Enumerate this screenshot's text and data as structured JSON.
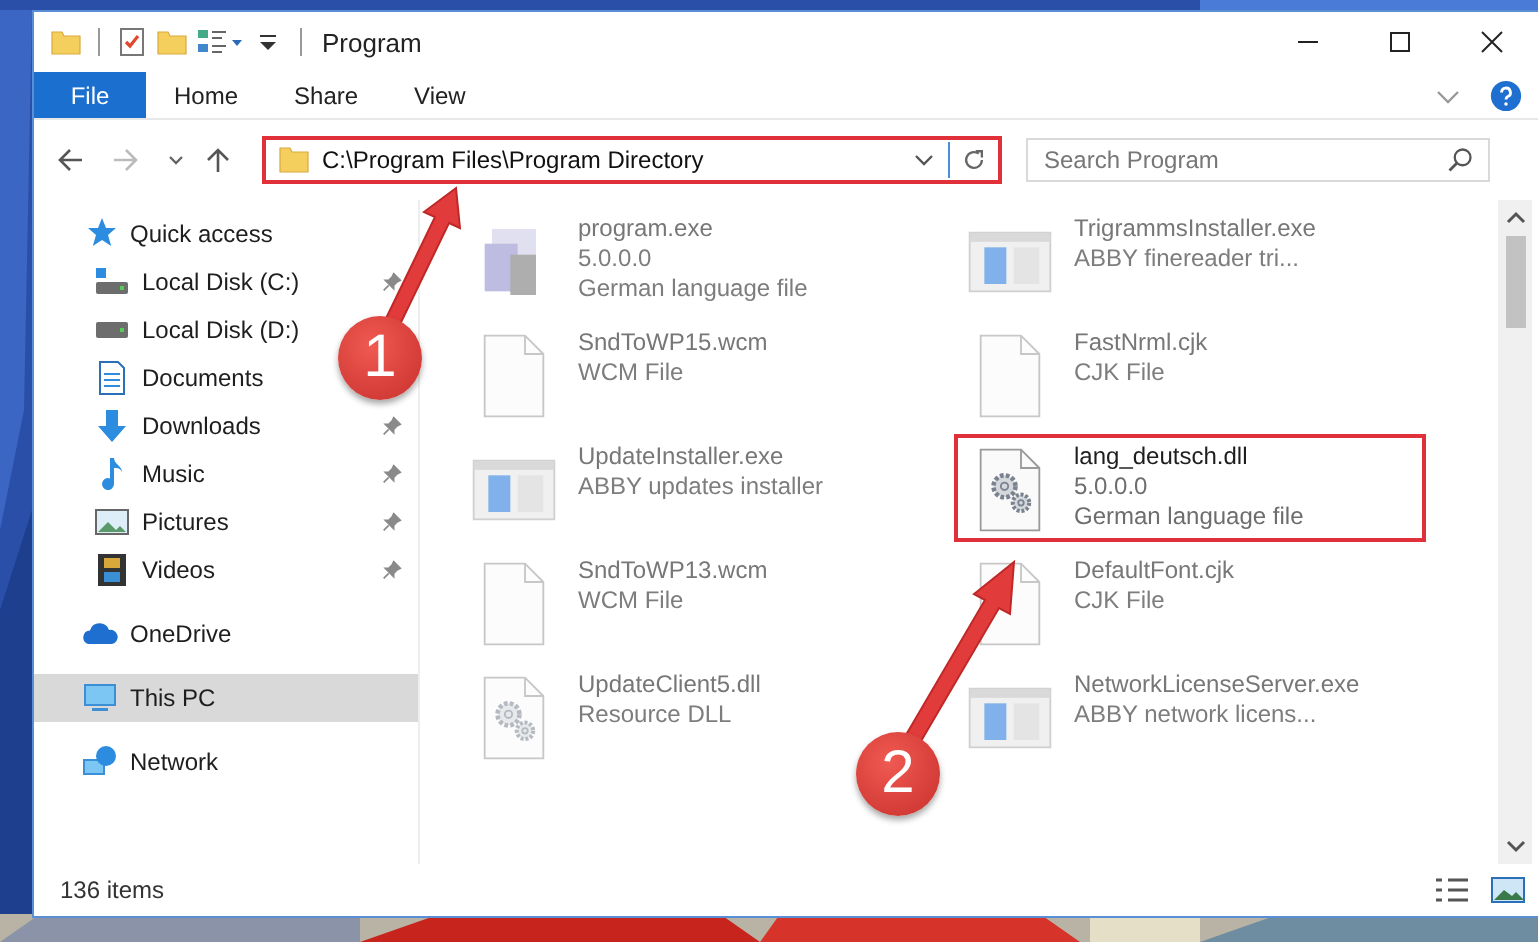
{
  "window": {
    "title": "Program"
  },
  "ribbon": {
    "tabs": [
      {
        "label": "File",
        "kind": "file",
        "selected": false
      },
      {
        "label": "Home",
        "kind": "tab",
        "selected": false
      },
      {
        "label": "Share",
        "kind": "tab",
        "selected": false
      },
      {
        "label": "View",
        "kind": "tab",
        "selected": false
      }
    ]
  },
  "address": {
    "path": "C:\\Program Files\\Program Directory",
    "highlighted": true
  },
  "search": {
    "placeholder": "Search Program"
  },
  "sidebar": {
    "items": [
      {
        "label": "Quick access",
        "kind": "quick-access",
        "selected": false,
        "children": [
          {
            "label": "Local Disk (C:)",
            "kind": "system-drive",
            "pinned": true,
            "selected": false
          },
          {
            "label": "Local Disk (D:)",
            "kind": "drive",
            "pinned": false,
            "selected": false
          },
          {
            "label": "Documents",
            "kind": "documents",
            "pinned": false,
            "selected": false
          },
          {
            "label": "Downloads",
            "kind": "downloads",
            "pinned": true,
            "selected": false
          },
          {
            "label": "Music",
            "kind": "music",
            "pinned": true,
            "selected": false
          },
          {
            "label": "Pictures",
            "kind": "pictures",
            "pinned": true,
            "selected": false
          },
          {
            "label": "Videos",
            "kind": "videos",
            "pinned": true,
            "selected": false
          }
        ]
      },
      {
        "label": "OneDrive",
        "kind": "cloud",
        "selected": false
      },
      {
        "label": "This PC",
        "kind": "computer",
        "selected": true
      },
      {
        "label": "Network",
        "kind": "network",
        "selected": false
      }
    ]
  },
  "files": [
    {
      "name": "program.exe",
      "details": [
        "5.0.0.0",
        "German language file"
      ],
      "kind": "application",
      "blurred": true,
      "highlighted": false
    },
    {
      "name": "TrigrammsInstaller.exe",
      "details": [
        "ABBY finereader tri..."
      ],
      "kind": "installer",
      "blurred": true,
      "highlighted": false
    },
    {
      "name": "SndToWP15.wcm",
      "details": [
        "WCM File"
      ],
      "kind": "document",
      "blurred": true,
      "highlighted": false
    },
    {
      "name": "FastNrml.cjk",
      "details": [
        "CJK File"
      ],
      "kind": "document",
      "blurred": true,
      "highlighted": false
    },
    {
      "name": "UpdateInstaller.exe",
      "details": [
        "ABBY updates installer"
      ],
      "kind": "installer",
      "blurred": true,
      "highlighted": false
    },
    {
      "name": "lang_deutsch.dll",
      "details": [
        "5.0.0.0",
        "German language file"
      ],
      "kind": "library",
      "blurred": false,
      "highlighted": true
    },
    {
      "name": "SndToWP13.wcm",
      "details": [
        "WCM File"
      ],
      "kind": "document",
      "blurred": true,
      "highlighted": false
    },
    {
      "name": "DefaultFont.cjk",
      "details": [
        "CJK File"
      ],
      "kind": "document",
      "blurred": true,
      "highlighted": false
    },
    {
      "name": "UpdateClient5.dll",
      "details": [
        "Resource DLL"
      ],
      "kind": "library",
      "blurred": true,
      "highlighted": false
    },
    {
      "name": "NetworkLicenseServer.exe",
      "details": [
        "ABBY network licens..."
      ],
      "kind": "installer",
      "blurred": true,
      "highlighted": false
    }
  ],
  "status_bar": {
    "count": "136 items"
  },
  "callouts": [
    {
      "label": "1"
    },
    {
      "label": "2"
    }
  ]
}
